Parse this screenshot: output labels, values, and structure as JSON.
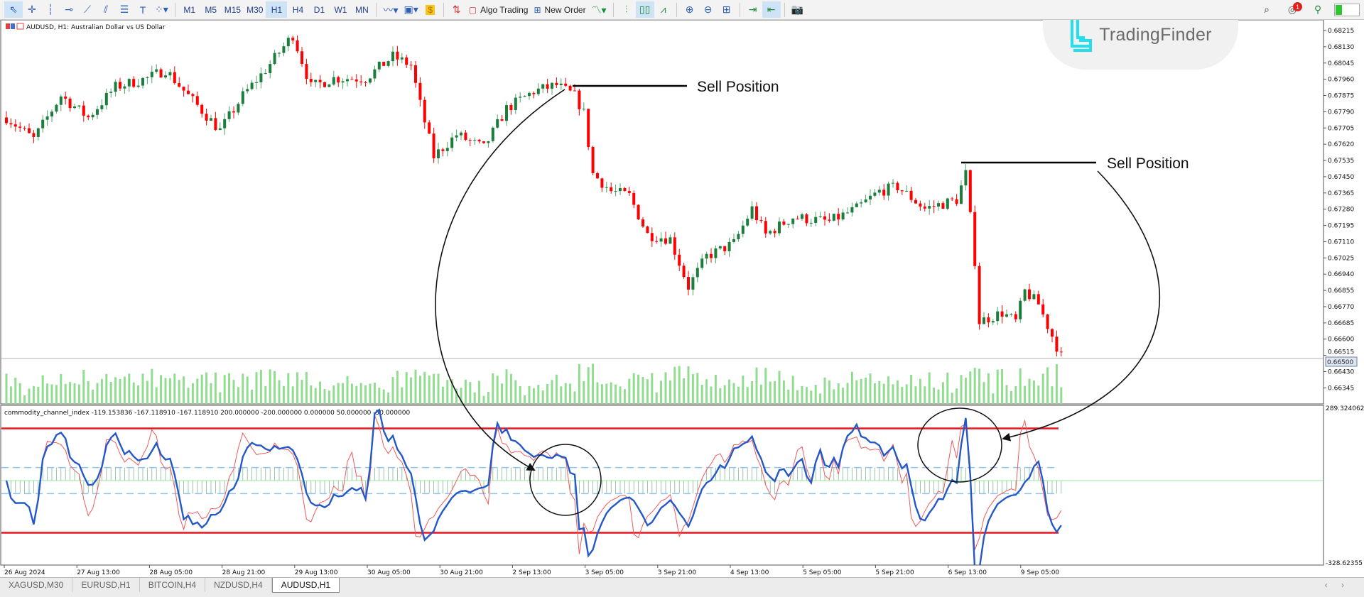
{
  "toolbar": {
    "tools": [
      {
        "icon": "cursor-icon",
        "glyph": "⇖",
        "active": true
      },
      {
        "icon": "crosshair-icon",
        "glyph": "✛"
      },
      {
        "icon": "vertical-line-icon",
        "glyph": "┆"
      },
      {
        "icon": "horizontal-line-icon",
        "glyph": "⊸"
      },
      {
        "icon": "trendline-icon",
        "glyph": "⟋"
      },
      {
        "icon": "channel-icon",
        "glyph": "⫽"
      },
      {
        "icon": "fibonacci-icon",
        "glyph": "☰"
      },
      {
        "icon": "text-icon",
        "glyph": "T"
      },
      {
        "icon": "shapes-icon",
        "glyph": "⁘▾"
      }
    ],
    "timeframes": [
      "M1",
      "M5",
      "M15",
      "M30",
      "H1",
      "H4",
      "D1",
      "W1",
      "MN"
    ],
    "active_timeframe": "H1",
    "algo_trading_label": "Algo Trading",
    "new_order_label": "New Order",
    "notification_count": "1"
  },
  "watermark": {
    "brand": "TradingFinder",
    "color": "#22e0f0"
  },
  "chart": {
    "title": "AUDUSD, H1:  Australian Dollar vs US Dollar",
    "price_labels": [
      "0.68215",
      "0.68130",
      "0.68045",
      "0.67960",
      "0.67875",
      "0.67790",
      "0.67705",
      "0.67620",
      "0.67535",
      "0.67450",
      "0.67365",
      "0.67280",
      "0.67195",
      "0.67110",
      "0.67025",
      "0.66940",
      "0.66855",
      "0.66770",
      "0.66685",
      "0.66600",
      "0.66515",
      "0.66430",
      "0.66345"
    ],
    "current_price": "0.66500",
    "time_labels": [
      "26 Aug 2024",
      "27 Aug 13:00",
      "28 Aug 05:00",
      "28 Aug 21:00",
      "29 Aug 13:00",
      "30 Aug 05:00",
      "30 Aug 21:00",
      "2 Sep 13:00",
      "3 Sep 05:00",
      "3 Sep 21:00",
      "4 Sep 13:00",
      "5 Sep 05:00",
      "5 Sep 21:00",
      "6 Sep 13:00",
      "9 Sep 05:00"
    ],
    "annotations": [
      {
        "label": "Sell Position"
      },
      {
        "label": "Sell Position"
      }
    ],
    "colors": {
      "bull": "#1c7d3c",
      "bear": "#ff0000",
      "volume": "#92dc92",
      "cci_main": "#2458c8",
      "cci_signal": "#f05a5a",
      "level_200": "#e8141e",
      "level_50": "#8cc4f0",
      "histogram": "#7fb89a"
    }
  },
  "indicator": {
    "label": "commodity_channel_index -119.153836 -167.118910 -167.118910 200.000000 -200.000000 0.000000 50.000000 -50.000000",
    "axis_max": "289.324062",
    "axis_min": "-328.62355",
    "levels": [
      200,
      -200,
      0,
      50,
      -50
    ]
  },
  "chart_data": {
    "type": "candlestick",
    "symbol": "AUDUSD",
    "timeframe": "H1",
    "ylim": [
      0.66345,
      0.68215
    ],
    "close_anchors": [
      [
        0,
        0.6776
      ],
      [
        6,
        0.67647
      ],
      [
        12,
        0.67874
      ],
      [
        18,
        0.6776
      ],
      [
        24,
        0.6792
      ],
      [
        31,
        0.67965
      ],
      [
        35,
        0.6801
      ],
      [
        40,
        0.67874
      ],
      [
        47,
        0.67692
      ],
      [
        52,
        0.67874
      ],
      [
        57,
        0.6801
      ],
      [
        63,
        0.68192
      ],
      [
        67,
        0.6792
      ],
      [
        72,
        0.67965
      ],
      [
        79,
        0.67965
      ],
      [
        85,
        0.68079
      ],
      [
        89,
        0.68033
      ],
      [
        91,
        0.67829
      ],
      [
        94,
        0.67556
      ],
      [
        99,
        0.6767
      ],
      [
        105,
        0.67601
      ],
      [
        110,
        0.67806
      ],
      [
        116,
        0.67897
      ],
      [
        121,
        0.67929
      ],
      [
        125,
        0.67874
      ],
      [
        127,
        0.67783
      ],
      [
        129,
        0.67465
      ],
      [
        133,
        0.67374
      ],
      [
        137,
        0.67351
      ],
      [
        141,
        0.67147
      ],
      [
        146,
        0.67124
      ],
      [
        150,
        0.66874
      ],
      [
        154,
        0.67033
      ],
      [
        160,
        0.67101
      ],
      [
        164,
        0.67283
      ],
      [
        167,
        0.67147
      ],
      [
        173,
        0.67238
      ],
      [
        181,
        0.67215
      ],
      [
        187,
        0.67283
      ],
      [
        192,
        0.67374
      ],
      [
        196,
        0.67397
      ],
      [
        202,
        0.67283
      ],
      [
        209,
        0.67329
      ],
      [
        211,
        0.67465
      ],
      [
        213,
        0.6701
      ],
      [
        214,
        0.66692
      ],
      [
        219,
        0.66738
      ],
      [
        222,
        0.66692
      ],
      [
        224,
        0.66851
      ],
      [
        227,
        0.66783
      ],
      [
        229,
        0.6667
      ],
      [
        232,
        0.6651
      ]
    ],
    "cci_ylim": [
      -328.62355,
      289.324062
    ]
  },
  "tabs": [
    {
      "label": "XAGUSD,M30"
    },
    {
      "label": "EURUSD,H1"
    },
    {
      "label": "BITCOIN,H4"
    },
    {
      "label": "NZDUSD,H4"
    },
    {
      "label": "AUDUSD,H1",
      "active": true
    }
  ]
}
